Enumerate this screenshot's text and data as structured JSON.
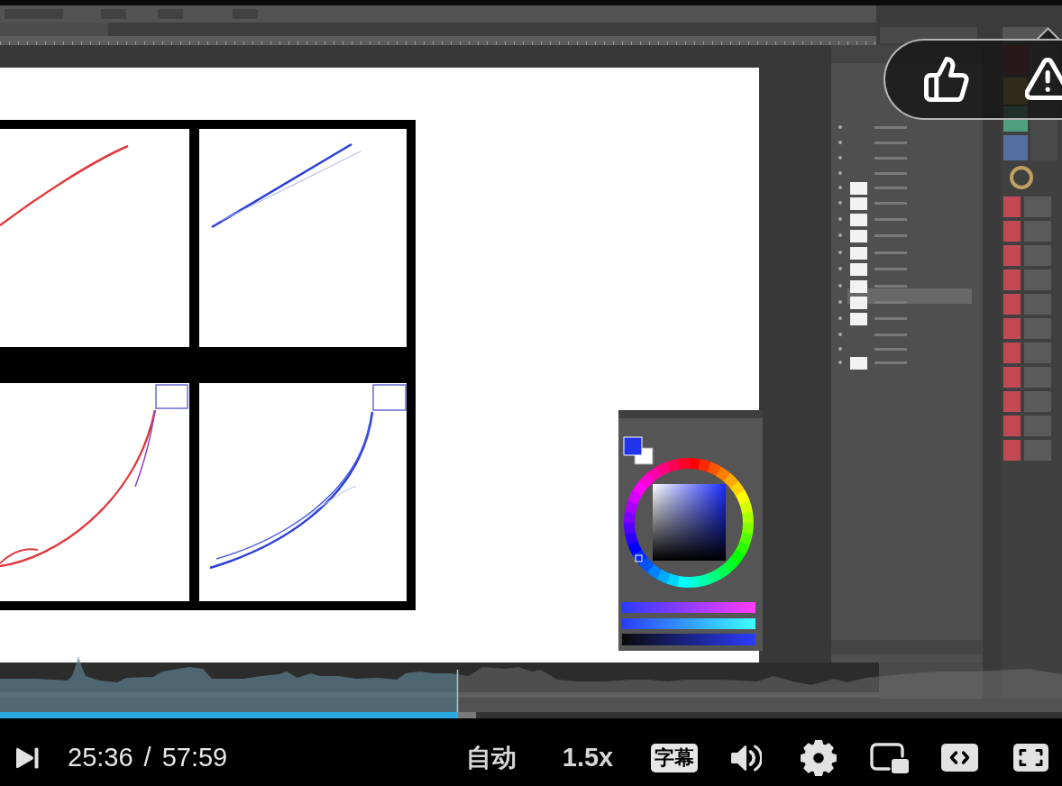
{
  "player": {
    "progress": {
      "level": 0.431,
      "buffered": {
        "level": 0.448
      }
    },
    "time": {
      "current": "25:36",
      "separator": "/",
      "duration": "57:59"
    },
    "quality": "自动",
    "speed": "1.5x",
    "subtitles": {
      "label": "字幕",
      "on": true
    }
  }
}
